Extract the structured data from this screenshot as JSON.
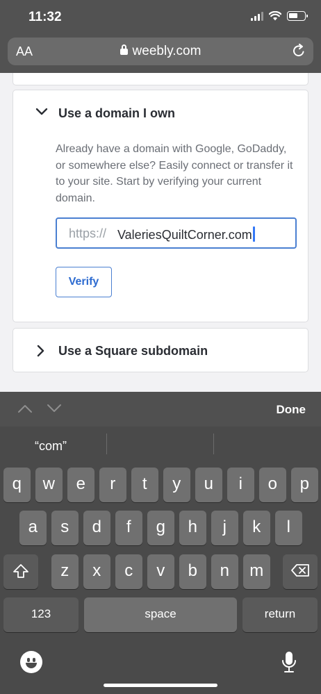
{
  "status_bar": {
    "time": "11:32"
  },
  "browser": {
    "text_size_label": "AA",
    "url": "weebly.com"
  },
  "domain_card": {
    "title": "Use a domain I own",
    "description": "Already have a domain with Google, GoDaddy, or somewhere else? Easily connect or transfer it to your site. Start by verifying your current domain.",
    "prefix": "https://",
    "value": "ValeriesQuiltCorner.com",
    "verify_label": "Verify"
  },
  "subdomain_card": {
    "title": "Use a Square subdomain"
  },
  "keyboard": {
    "done_label": "Done",
    "prediction": "“com”",
    "row1": [
      "q",
      "w",
      "e",
      "r",
      "t",
      "y",
      "u",
      "i",
      "o",
      "p"
    ],
    "row2": [
      "a",
      "s",
      "d",
      "f",
      "g",
      "h",
      "j",
      "k",
      "l"
    ],
    "row3": [
      "z",
      "x",
      "c",
      "v",
      "b",
      "n",
      "m"
    ],
    "numbers_label": "123",
    "space_label": "space",
    "return_label": "return"
  }
}
